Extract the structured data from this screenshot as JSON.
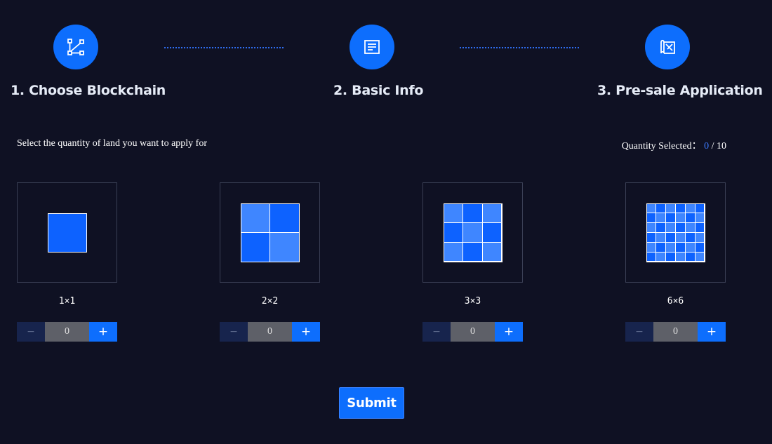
{
  "steps": [
    {
      "label": "1. Choose Blockchain",
      "icon": "blockchain-nodes-icon"
    },
    {
      "label": "2. Basic Info",
      "icon": "document-icon"
    },
    {
      "label": "3. Pre-sale Application",
      "icon": "map-icon"
    }
  ],
  "instruction": "Select the quantity of land you want to apply for",
  "quantity": {
    "label": "Quantity Selected：",
    "current": "0",
    "separator": " / ",
    "max": "10"
  },
  "tiles": [
    {
      "label": "1×1",
      "size": 1,
      "value": "0"
    },
    {
      "label": "2×2",
      "size": 2,
      "value": "0"
    },
    {
      "label": "3×3",
      "size": 3,
      "value": "0"
    },
    {
      "label": "6×6",
      "size": 6,
      "value": "0"
    }
  ],
  "stepper": {
    "minus": "−",
    "plus": "+"
  },
  "submit_label": "Submit",
  "colors": {
    "background": "#0f1123",
    "accent": "#0d6efd",
    "tile_dark": "#0d62ff",
    "tile_light": "#3f86ff"
  }
}
